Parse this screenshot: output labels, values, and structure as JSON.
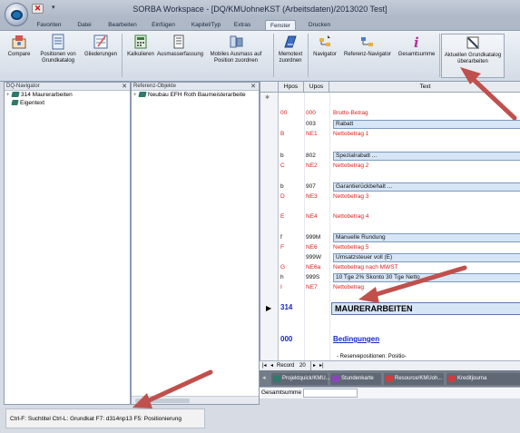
{
  "window": {
    "title": "SORBA Workspace - [DQ/KMUohneKST (Arbeitsdaten)/2013020 Test]"
  },
  "ribbon_tabs": [
    "Favoriten",
    "Datei",
    "Bearbeiten",
    "Einfügen",
    "Kapitel/Typ",
    "Extras",
    "Fenster",
    "Drucken"
  ],
  "active_tab": "Fenster",
  "ribbon_buttons": [
    {
      "label": "Compare",
      "icon": "compare-icon"
    },
    {
      "label": "Positionen von Grundkatalog",
      "icon": "catalog-icon"
    },
    {
      "label": "Gliederungen",
      "icon": "outline-icon"
    },
    {
      "label": "Kalkulieren",
      "icon": "calculate-icon"
    },
    {
      "label": "Ausmasserfassung",
      "icon": "measurement-icon"
    },
    {
      "label": "Mobiles Ausmass auf Position zuordnen",
      "icon": "mobile-measure-icon"
    },
    {
      "label": "Memotext zuordnen",
      "icon": "memo-icon"
    },
    {
      "label": "Navigator",
      "icon": "navigator-icon"
    },
    {
      "label": "Referenz-Navigator",
      "icon": "reference-navigator-icon"
    },
    {
      "label": "Gesamtsumme",
      "icon": "total-icon"
    },
    {
      "label": "Aktuellen Grundkatalog überarbeiten",
      "icon": "edit-catalog-icon"
    }
  ],
  "dq_navigator": {
    "title": "DQ-Navigator",
    "items": [
      {
        "expander": "+",
        "label": "314 Maurerarbeiten"
      },
      {
        "expander": "",
        "label": "Eigentext"
      }
    ]
  },
  "reference_objects": {
    "title": "Referenz-Objekte",
    "items": [
      {
        "expander": "+",
        "label": "Neubau EFH Roth Baumeisterarbeite"
      }
    ]
  },
  "grid": {
    "columns": [
      "Hpos",
      "Upos",
      "Text"
    ],
    "rows": [
      {
        "hpos": "00",
        "upos": "000",
        "text": "Brutto-Betrag",
        "color": "red"
      },
      {
        "hpos": "",
        "upos": "003",
        "text": "Rabatt",
        "color": "black",
        "boxed": true
      },
      {
        "hpos": "B",
        "upos": "NE1",
        "text": "Nettobetrag 1",
        "color": "red"
      },
      {
        "hpos": "b",
        "upos": "802",
        "text": "Spezialrabatt ...",
        "color": "black",
        "boxed": true
      },
      {
        "hpos": "C",
        "upos": "NE2",
        "text": "Nettobetrag 2",
        "color": "red"
      },
      {
        "hpos": "b",
        "upos": "907",
        "text": "Garantierückbehalt ...",
        "color": "black",
        "boxed": true
      },
      {
        "hpos": "D",
        "upos": "NE3",
        "text": "Nettobetrag 3",
        "color": "red"
      },
      {
        "hpos": "E",
        "upos": "NE4",
        "text": "Nettobetrag 4",
        "color": "red"
      },
      {
        "hpos": "f",
        "upos": "999M",
        "text": "Manuelle Rundung",
        "color": "black",
        "boxed": true
      },
      {
        "hpos": "F",
        "upos": "NE6",
        "text": "Nettobetrag 5",
        "color": "red"
      },
      {
        "hpos": "",
        "upos": "999W",
        "text": "Umsatzsteuer voll (E)",
        "color": "black",
        "boxed": true
      },
      {
        "hpos": "G",
        "upos": "NE6a",
        "text": "Nettobetrag nach MWST",
        "color": "red"
      },
      {
        "hpos": "h",
        "upos": "999S",
        "text": "10 Tge 2% Skonto 30 Tge Netto",
        "color": "black",
        "boxed": true
      },
      {
        "hpos": "I",
        "upos": "NE7",
        "text": "Nettobetrag",
        "color": "red"
      }
    ],
    "chapter": {
      "number": "314",
      "title": "MAURERARBEITEN"
    },
    "section": {
      "number": "000",
      "title": "Bedingungen"
    },
    "partial_text": "- Reservepositionen: Positio-"
  },
  "record_nav": {
    "label": "Record",
    "value": "20"
  },
  "document_tabs": [
    {
      "label": "Projektquick/KMU...",
      "color": "#2f7a6b"
    },
    {
      "label": "Stundenkarte",
      "color": "#8a45b8"
    },
    {
      "label": "Resource/KMUoh...",
      "color": "#c94040"
    },
    {
      "label": "Kreditjourna",
      "color": "#c94040"
    }
  ],
  "summary_row": {
    "label": "Gesamtsumme"
  },
  "status_bar": {
    "text": "Ctrl-F: Suchtitel  Ctrl-L: Grundkat  F7: d314np13  F5: Positionierung"
  },
  "colors": {
    "annotation_arrow": "#c0504d",
    "red_text": "#e02020",
    "chapter_blue": "#1428c8"
  }
}
